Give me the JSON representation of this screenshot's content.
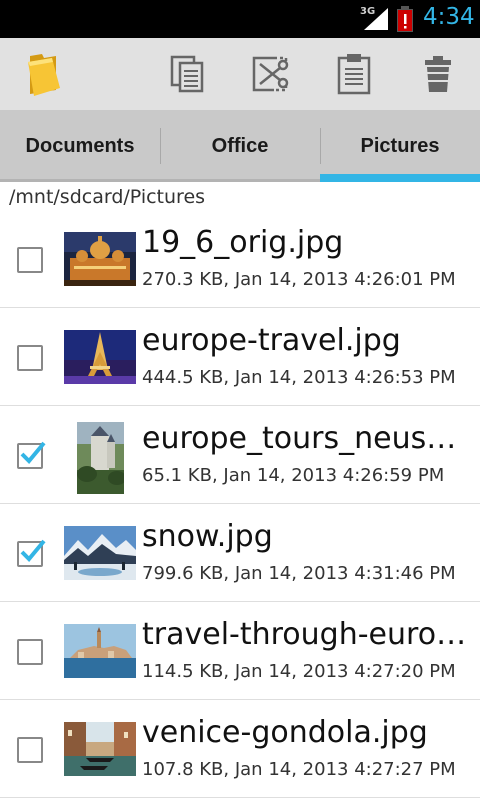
{
  "status_bar": {
    "network": "3G",
    "time": "4:34"
  },
  "toolbar": {
    "icons": [
      "folder-icon",
      "copy-icon",
      "cut-icon",
      "paste-icon",
      "trash-icon"
    ]
  },
  "tabs": [
    {
      "label": "Documents",
      "selected": false
    },
    {
      "label": "Office",
      "selected": false
    },
    {
      "label": "Pictures",
      "selected": true
    }
  ],
  "path": "/mnt/sdcard/Pictures",
  "files": [
    {
      "name": "19_6_orig.jpg",
      "meta": "270.3 KB, Jan 14, 2013 4:26:01 PM",
      "checked": false,
      "thumb": "cathedral-night"
    },
    {
      "name": "europe-travel.jpg",
      "meta": "444.5 KB, Jan 14, 2013 4:26:53 PM",
      "checked": false,
      "thumb": "eiffel-tower"
    },
    {
      "name": "europe_tours_neuschwanstein.jpg",
      "meta": "65.1 KB, Jan 14, 2013 4:26:59 PM",
      "checked": true,
      "thumb": "castle"
    },
    {
      "name": "snow.jpg",
      "meta": "799.6 KB, Jan 14, 2013 4:31:46 PM",
      "checked": true,
      "thumb": "snow-mountains"
    },
    {
      "name": "travel-through-europe.jpg",
      "meta": "114.5 KB, Jan 14, 2013 4:27:20 PM",
      "checked": false,
      "thumb": "coastal-town"
    },
    {
      "name": "venice-gondola.jpg",
      "meta": "107.8 KB, Jan 14, 2013 4:27:27 PM",
      "checked": false,
      "thumb": "venice-canal"
    }
  ],
  "colors": {
    "accent": "#33b5e5",
    "tab_bg": "#c9c9c9",
    "toolbar_bg": "#e1e1e1"
  }
}
